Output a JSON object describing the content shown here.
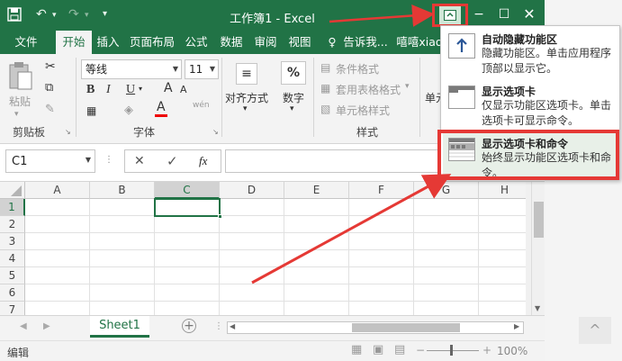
{
  "window": {
    "title": "工作簿1 - Excel"
  },
  "quick_access": {
    "save_icon": "save-icon",
    "undo_icon": "undo-icon",
    "redo_icon": "redo-icon",
    "customize_icon": "customize-icon"
  },
  "tabs": [
    {
      "label": "文件"
    },
    {
      "label": "开始"
    },
    {
      "label": "插入"
    },
    {
      "label": "页面布局"
    },
    {
      "label": "公式"
    },
    {
      "label": "数据"
    },
    {
      "label": "审阅"
    },
    {
      "label": "视图"
    },
    {
      "label": "告诉我..."
    },
    {
      "label": "嘻嘻xiao"
    }
  ],
  "ribbon": {
    "clipboard": {
      "paste_label": "粘贴",
      "group_label": "剪贴板"
    },
    "font": {
      "font_name": "等线",
      "font_size": "11",
      "bold": "B",
      "italic": "I",
      "underline": "U",
      "group_label": "字体",
      "grow": "A",
      "shrink": "A",
      "font_color": "A",
      "wen": "wén"
    },
    "alignment": {
      "label": "对齐方式"
    },
    "number": {
      "label": "数字",
      "icon": "%"
    },
    "styles": {
      "cond": "条件格式",
      "table": "套用表格格式",
      "cell": "单元格样式",
      "group_label": "样式"
    },
    "cells": {
      "label": "单元"
    }
  },
  "formula_bar": {
    "name_box": "C1",
    "fx": "fx",
    "cancel": "✕",
    "enter": "✓"
  },
  "grid": {
    "columns": [
      "A",
      "B",
      "C",
      "D",
      "E",
      "F",
      "G",
      "H"
    ],
    "rows": [
      "1",
      "2",
      "3",
      "4",
      "5",
      "6",
      "7"
    ],
    "selected_cell": "C1"
  },
  "sheets": [
    {
      "label": "Sheet1"
    }
  ],
  "status": {
    "mode": "编辑",
    "zoom": "100%"
  },
  "display_options_menu": {
    "items": [
      {
        "title": "自动隐藏功能区",
        "desc": "隐藏功能区。单击应用程序顶部以显示它。"
      },
      {
        "title": "显示选项卡",
        "desc": "仅显示功能区选项卡。单击选项卡可显示命令。"
      },
      {
        "title": "显示选项卡和命令",
        "desc": "始终显示功能区选项卡和命令。"
      }
    ]
  },
  "colors": {
    "excel_green": "#217346",
    "highlight_red": "#e53935"
  }
}
